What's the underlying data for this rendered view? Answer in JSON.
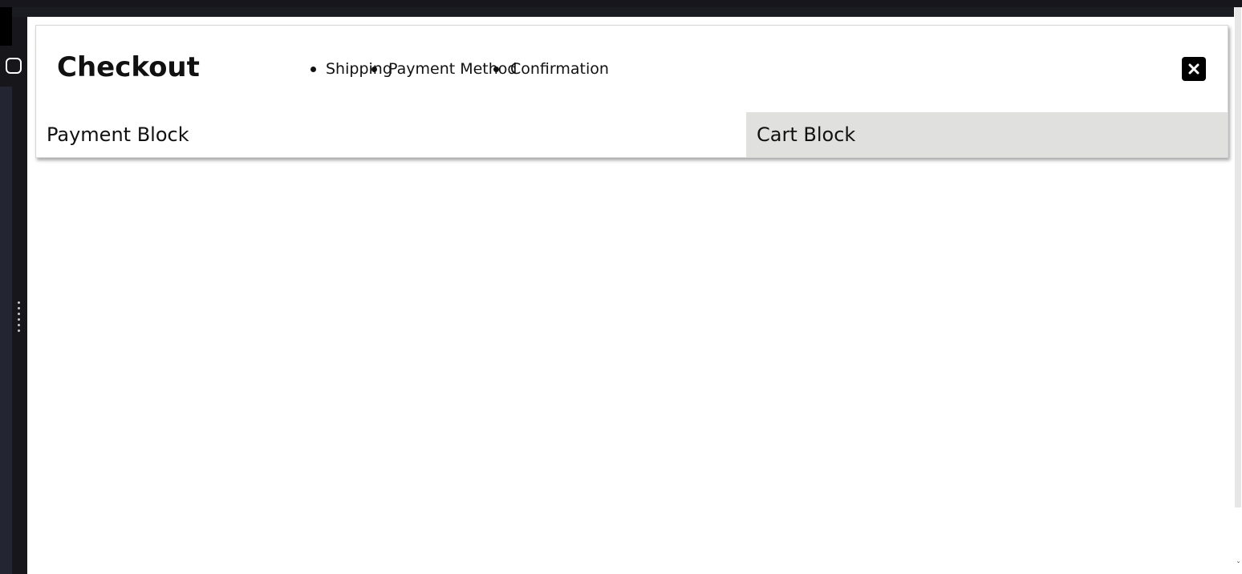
{
  "checkout": {
    "title": "Checkout",
    "steps": [
      "Shipping",
      "Payment Method",
      "Confirmation"
    ],
    "close_icon": "close-icon"
  },
  "blocks": {
    "payment_label": "Payment Block",
    "cart_label": "Cart Block"
  },
  "colors": {
    "background": "#16161c",
    "cart_block_bg": "#e0e0df",
    "close_button_bg": "#000000"
  }
}
